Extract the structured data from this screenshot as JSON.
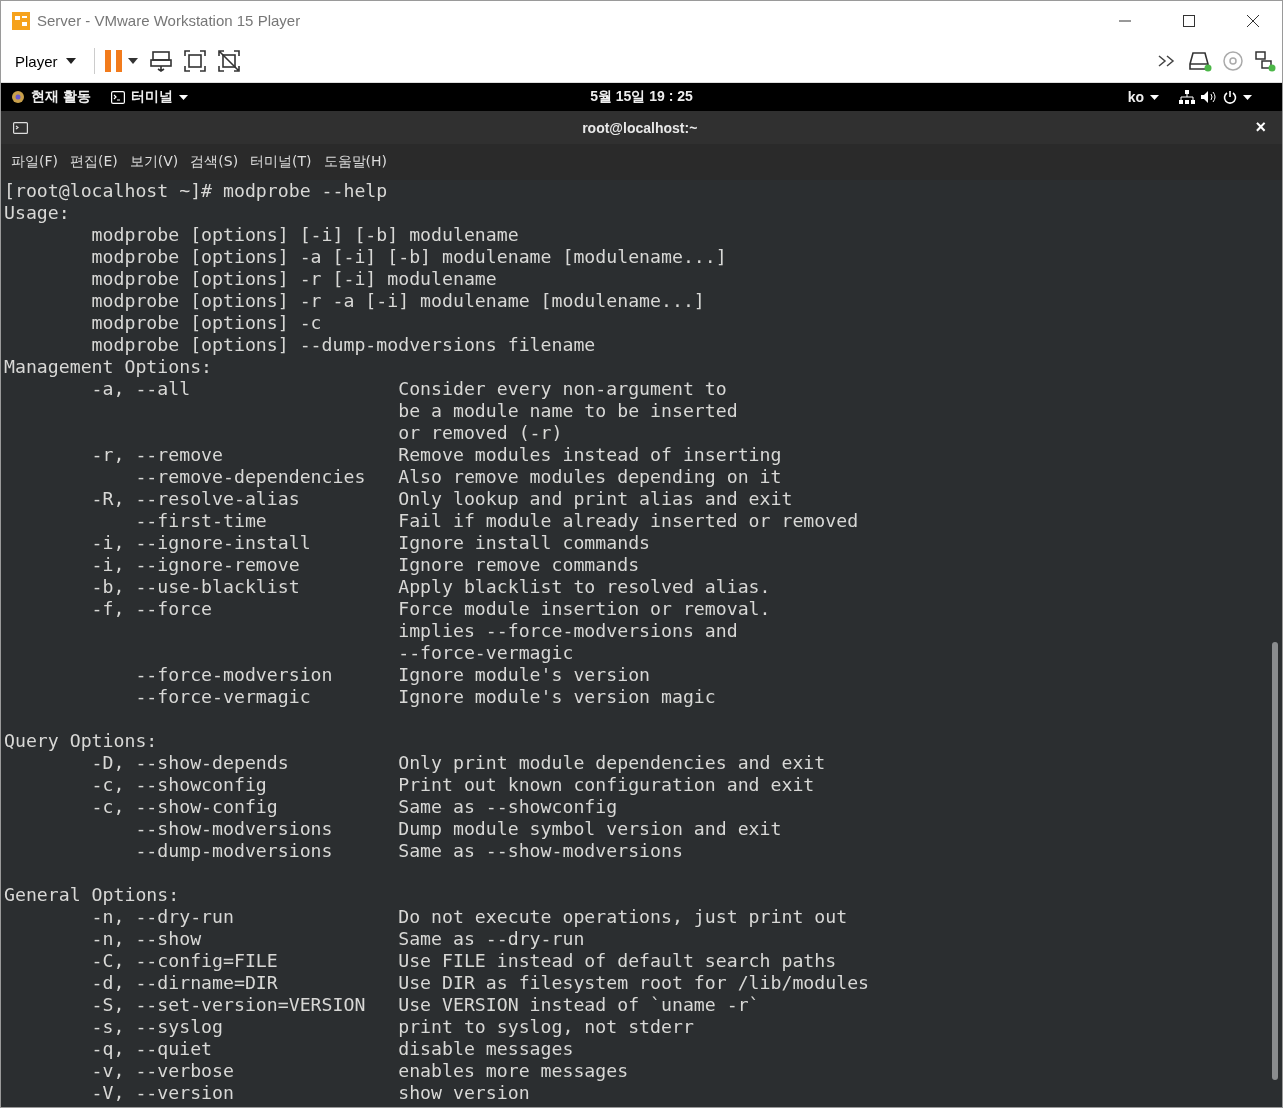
{
  "window": {
    "title": "Server - VMware Workstation 15 Player"
  },
  "toolbar": {
    "player_menu": "Player"
  },
  "top_bar": {
    "activities": "현재 활동",
    "app_menu": "터미널",
    "clock": "5월 15일  19 : 25",
    "input_source": "ko"
  },
  "terminal": {
    "title": "root@localhost:~",
    "close": "×",
    "menu": [
      "파일(F)",
      "편집(E)",
      "보기(V)",
      "검색(S)",
      "터미널(T)",
      "도움말(H)"
    ],
    "blocks": [
      [
        "[root@localhost ~]# modprobe --help",
        "Usage:",
        "        modprobe [options] [-i] [-b] modulename",
        "        modprobe [options] -a [-i] [-b] modulename [modulename...]",
        "        modprobe [options] -r [-i] modulename",
        "        modprobe [options] -r -a [-i] modulename [modulename...]",
        "        modprobe [options] -c",
        "        modprobe [options] --dump-modversions filename",
        "Management Options:",
        "        -a, --all                   Consider every non-argument to",
        "                                    be a module name to be inserted",
        "                                    or removed (-r)",
        "        -r, --remove                Remove modules instead of inserting",
        "            --remove-dependencies   Also remove modules depending on it",
        "        -R, --resolve-alias         Only lookup and print alias and exit",
        "            --first-time            Fail if module already inserted or removed",
        "        -i, --ignore-install        Ignore install commands",
        "        -i, --ignore-remove         Ignore remove commands",
        "        -b, --use-blacklist         Apply blacklist to resolved alias.",
        "        -f, --force                 Force module insertion or removal.",
        "                                    implies --force-modversions and",
        "                                    --force-vermagic",
        "            --force-modversion      Ignore module's version",
        "            --force-vermagic        Ignore module's version magic"
      ],
      [
        "Query Options:",
        "        -D, --show-depends          Only print module dependencies and exit",
        "        -c, --showconfig            Print out known configuration and exit",
        "        -c, --show-config           Same as --showconfig",
        "            --show-modversions      Dump module symbol version and exit",
        "            --dump-modversions      Same as --show-modversions"
      ],
      [
        "General Options:",
        "        -n, --dry-run               Do not execute operations, just print out",
        "        -n, --show                  Same as --dry-run",
        "        -C, --config=FILE           Use FILE instead of default search paths",
        "        -d, --dirname=DIR           Use DIR as filesystem root for /lib/modules",
        "        -S, --set-version=VERSION   Use VERSION instead of `uname -r`",
        "        -s, --syslog                print to syslog, not stderr",
        "        -q, --quiet                 disable messages",
        "        -v, --verbose               enables more messages",
        "        -V, --version               show version"
      ]
    ]
  }
}
